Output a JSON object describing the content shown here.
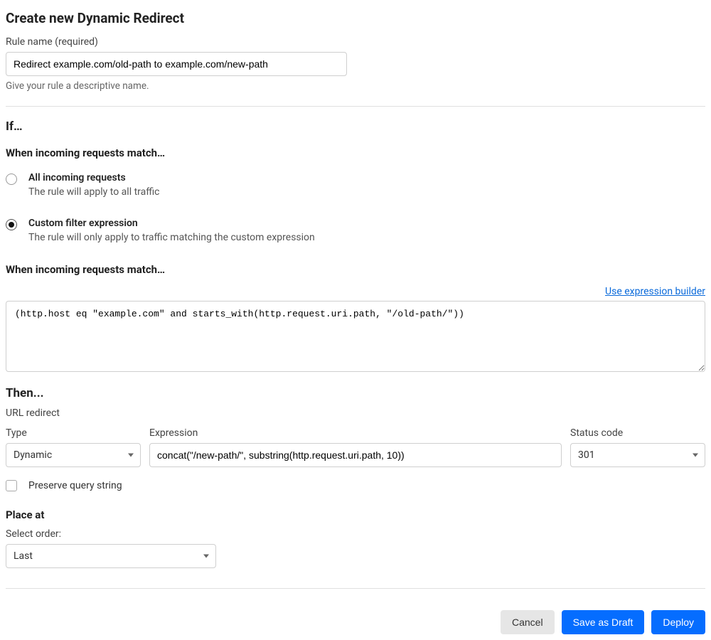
{
  "page_title": "Create new Dynamic Redirect",
  "rule_name": {
    "label": "Rule name (required)",
    "value": "Redirect example.com/old-path to example.com/new-path",
    "help": "Give your rule a descriptive name."
  },
  "if_section": {
    "heading": "If…",
    "match_heading": "When incoming requests match…",
    "options": {
      "all": {
        "title": "All incoming requests",
        "desc": "The rule will apply to all traffic",
        "selected": false
      },
      "custom": {
        "title": "Custom filter expression",
        "desc": "The rule will only apply to traffic matching the custom expression",
        "selected": true
      }
    },
    "match_heading_2": "When incoming requests match…",
    "builder_link": "Use expression builder",
    "expression": "(http.host eq \"example.com\" and starts_with(http.request.uri.path, \"/old-path/\"))"
  },
  "then_section": {
    "heading": "Then...",
    "subtitle": "URL redirect",
    "type": {
      "label": "Type",
      "value": "Dynamic"
    },
    "expression": {
      "label": "Expression",
      "value": "concat(\"/new-path/\", substring(http.request.uri.path, 10))"
    },
    "status": {
      "label": "Status code",
      "value": "301"
    },
    "preserve_query": {
      "label": "Preserve query string",
      "checked": false
    }
  },
  "place_at": {
    "heading": "Place at",
    "label": "Select order:",
    "value": "Last"
  },
  "footer": {
    "cancel": "Cancel",
    "save_draft": "Save as Draft",
    "deploy": "Deploy"
  }
}
